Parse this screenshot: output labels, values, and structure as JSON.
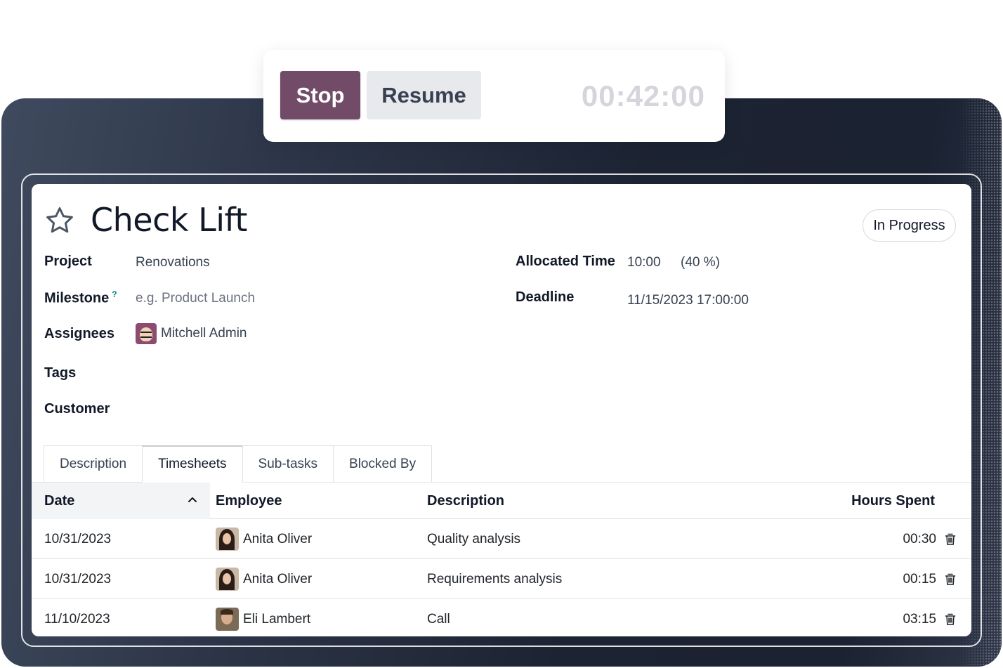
{
  "timer": {
    "stop_label": "Stop",
    "resume_label": "Resume",
    "elapsed": "00:42:00"
  },
  "task": {
    "title": "Check Lift",
    "status": "In Progress",
    "fields": {
      "project_label": "Project",
      "project_value": "Renovations",
      "milestone_label": "Milestone",
      "milestone_help": "?",
      "milestone_placeholder": "e.g. Product Launch",
      "assignees_label": "Assignees",
      "assignee_name": "Mitchell Admin",
      "tags_label": "Tags",
      "customer_label": "Customer",
      "allocated_label": "Allocated Time",
      "allocated_value": "10:00",
      "allocated_percent": "(40 %)",
      "deadline_label": "Deadline",
      "deadline_value": "11/15/2023 17:00:00"
    }
  },
  "tabs": [
    {
      "label": "Description"
    },
    {
      "label": "Timesheets"
    },
    {
      "label": "Sub-tasks"
    },
    {
      "label": "Blocked By"
    }
  ],
  "timesheets": {
    "columns": {
      "date": "Date",
      "employee": "Employee",
      "description": "Description",
      "hours": "Hours Spent"
    },
    "rows": [
      {
        "date": "10/31/2023",
        "employee": "Anita Oliver",
        "description": "Quality analysis",
        "hours": "00:30"
      },
      {
        "date": "10/31/2023",
        "employee": "Anita Oliver",
        "description": "Requirements analysis",
        "hours": "00:15"
      },
      {
        "date": "11/10/2023",
        "employee": "Eli Lambert",
        "description": "Call",
        "hours": "03:15"
      }
    ]
  },
  "colors": {
    "stop_button": "#714b67",
    "resume_button": "#e7e9ed",
    "timer_text": "#d4d6dc",
    "backdrop": "#1c2333"
  }
}
